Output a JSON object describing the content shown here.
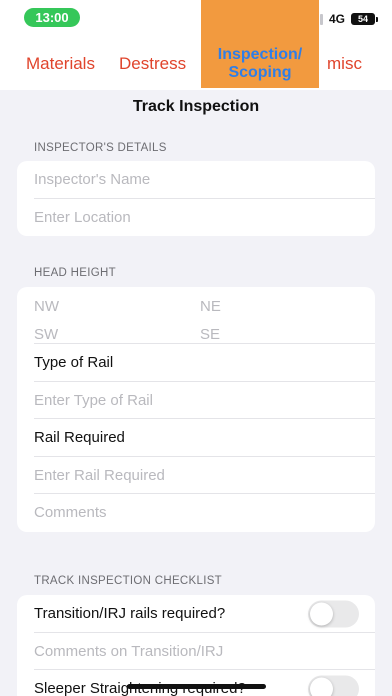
{
  "status_bar": {
    "time": "13:00",
    "network": "4G",
    "battery": "54"
  },
  "tabs": [
    {
      "label": "Materials",
      "active": false
    },
    {
      "label": "Destress",
      "active": false
    },
    {
      "label": "Inspection/ Scoping",
      "line1": "Inspection/",
      "line2": "Scoping",
      "active": true
    },
    {
      "label": "misc",
      "active": false
    }
  ],
  "colors": {
    "tab_text": "#e0442c",
    "active_tab_bg": "#f29a3f",
    "active_tab_text": "#2f7ee8",
    "time_pill": "#35c759"
  },
  "page_title": "Track Inspection",
  "inspector_section": {
    "header": "INSPECTOR'S DETAILS",
    "name_placeholder": "Inspector's Name",
    "location_placeholder": "Enter Location"
  },
  "head_height_section": {
    "header": "HEAD HEIGHT",
    "nw": "NW",
    "ne": "NE",
    "sw": "SW",
    "se": "SE",
    "type_of_rail_label": "Type of Rail",
    "type_of_rail_placeholder": "Enter Type of Rail",
    "rail_required_label": "Rail Required",
    "rail_required_placeholder": "Enter Rail Required",
    "comments_placeholder": "Comments"
  },
  "checklist_section": {
    "header": "TRACK INSPECTION CHECKLIST",
    "transition_label": "Transition/IRJ rails required?",
    "transition_on": false,
    "transition_comments_placeholder": "Comments on Transition/IRJ",
    "sleeper_label": "Sleeper Straightening required?",
    "sleeper_on": false
  }
}
